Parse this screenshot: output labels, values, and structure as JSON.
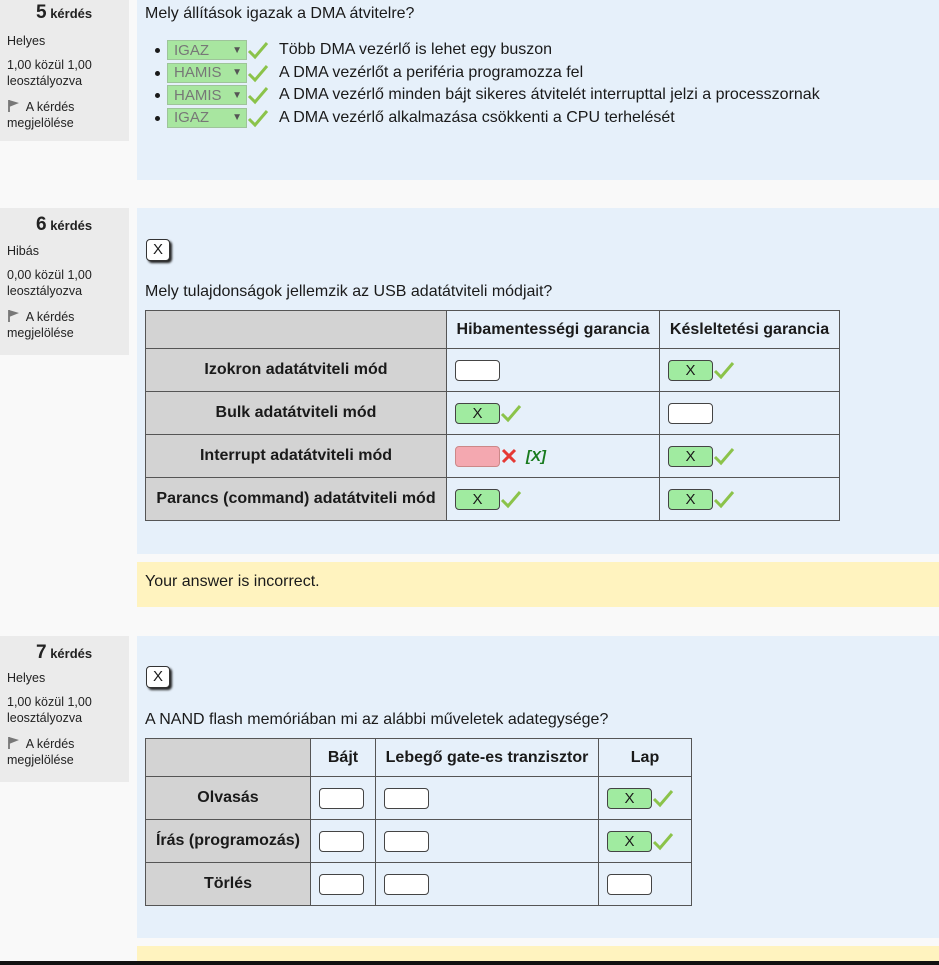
{
  "questions": {
    "q5": {
      "number": "5",
      "word": "kérdés",
      "state": "Helyes",
      "grade": "1,00 közül 1,00 leosztályozva",
      "flag_label": "A kérdés megjelölése",
      "text": "Mely állítások igazak a DMA átvitelre?",
      "statements": [
        {
          "answer": "IGAZ",
          "text": "Több DMA vezérlő is lehet egy buszon"
        },
        {
          "answer": "HAMIS",
          "text": "A DMA vezérlőt a periféria programozza fel"
        },
        {
          "answer": "HAMIS",
          "text": "A DMA vezérlő minden bájt sikeres átvitelét interrupttal jelzi a processzornak"
        },
        {
          "answer": "IGAZ",
          "text": "A DMA vezérlő alkalmazása csökkenti a CPU terhelését"
        }
      ]
    },
    "q6": {
      "number": "6",
      "word": "kérdés",
      "state": "Hibás",
      "grade": "0,00 közül 1,00 leosztályozva",
      "flag_label": "A kérdés megjelölése",
      "x_label": "X",
      "text": "Mely tulajdonságok jellemzik az USB adatátviteli módjait?",
      "col1": "Hibamentességi garancia",
      "col2": "Késleltetési garancia",
      "rows": [
        "Izokron adatátviteli mód",
        "Bulk adatátviteli mód",
        "Interrupt adatátviteli mód",
        "Parancs (command) adatátviteli mód"
      ],
      "mark": "X",
      "right_answer": "[X]",
      "feedback": "Your answer is incorrect."
    },
    "q7": {
      "number": "7",
      "word": "kérdés",
      "state": "Helyes",
      "grade": "1,00 közül 1,00 leosztályozva",
      "flag_label": "A kérdés megjelölése",
      "x_label": "X",
      "text": "A NAND flash memóriában mi az alábbi műveletek adategysége?",
      "col1": "Bájt",
      "col2": "Lebegő gate-es tranzisztor",
      "col3": "Lap",
      "rows": [
        "Olvasás",
        "Írás (programozás)",
        "Törlés"
      ],
      "mark": "X"
    }
  },
  "colors": {
    "content_bg": "#e6f0fa",
    "correct_fill": "#a0eba0",
    "wrong_fill": "#f4a8b0",
    "feedback_bg": "#fff3bf",
    "check_color": "#8bc34a",
    "cross_color": "#e53935"
  }
}
